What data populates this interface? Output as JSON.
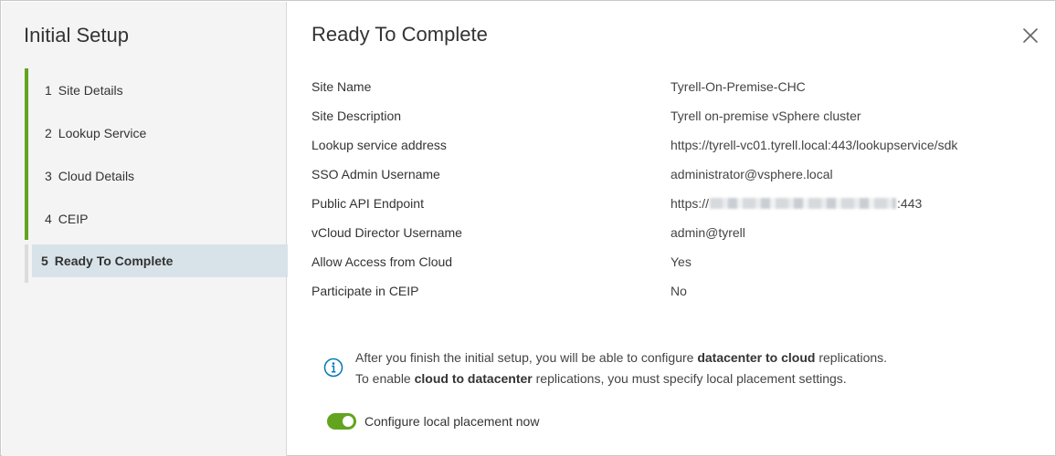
{
  "wizard": {
    "title": "Initial Setup",
    "steps": [
      {
        "number": "1",
        "label": "Site Details"
      },
      {
        "number": "2",
        "label": "Lookup Service"
      },
      {
        "number": "3",
        "label": "Cloud Details"
      },
      {
        "number": "4",
        "label": "CEIP"
      },
      {
        "number": "5",
        "label": "Ready To Complete"
      }
    ],
    "current_step": 5
  },
  "main": {
    "title": "Ready To Complete",
    "summary": [
      {
        "label": "Site Name",
        "value": "Tyrell-On-Premise-CHC"
      },
      {
        "label": "Site Description",
        "value": "Tyrell on-premise vSphere cluster"
      },
      {
        "label": "Lookup service address",
        "value": "https://tyrell-vc01.tyrell.local:443/lookupservice/sdk"
      },
      {
        "label": "SSO Admin Username",
        "value": "administrator@vsphere.local"
      },
      {
        "label": "Public API Endpoint",
        "value_prefix": "https://",
        "value_suffix": ":443"
      },
      {
        "label": "vCloud Director Username",
        "value": "admin@tyrell"
      },
      {
        "label": "Allow Access from Cloud",
        "value": "Yes"
      },
      {
        "label": "Participate in CEIP",
        "value": "No"
      }
    ],
    "info": {
      "line1_pre": "After you finish the initial setup, you will be able to configure ",
      "line1_bold": "datacenter to cloud",
      "line1_post": " replications.",
      "line2_pre": "To enable ",
      "line2_bold": "cloud to datacenter",
      "line2_post": " replications, you must specify local placement settings."
    },
    "toggle": {
      "label": "Configure local placement now",
      "checked": true
    }
  },
  "colors": {
    "accent_green": "#62a420",
    "selected_step_bg": "#d8e3e9",
    "info_icon": "#0079b8"
  }
}
